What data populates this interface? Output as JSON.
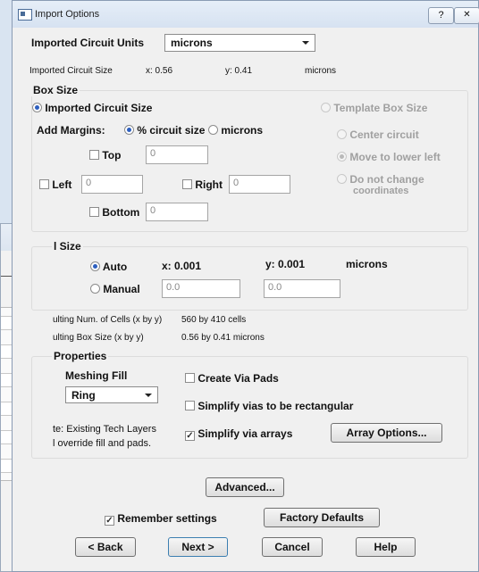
{
  "window": {
    "title": "Import Options",
    "help_button": "?",
    "close_button": "✕"
  },
  "units": {
    "label": "Imported Circuit Units",
    "value": "microns"
  },
  "circuit_size": {
    "label": "Imported Circuit Size",
    "x": "x: 0.56",
    "y": "y: 0.41",
    "units": "microns"
  },
  "box_size": {
    "title": "Box Size",
    "imported_option": "Imported Circuit Size",
    "template_option": "Template Box Size",
    "add_margins_label": "Add Margins:",
    "percent_option": "% circuit size",
    "microns_option": "microns",
    "top_label": "Top",
    "top_value": "0",
    "left_label": "Left",
    "left_value": "0",
    "right_label": "Right",
    "right_value": "0",
    "bottom_label": "Bottom",
    "bottom_value": "0",
    "center_option": "Center circuit",
    "move_option": "Move to lower left",
    "nochange_option_line1": "Do not change",
    "nochange_option_line2": "coordinates"
  },
  "cell_size": {
    "title": "l Size",
    "auto_option": "Auto",
    "manual_option": "Manual",
    "x": "x: 0.001",
    "y": "y: 0.001",
    "units": "microns",
    "manual_x": "0.0",
    "manual_y": "0.0"
  },
  "results": {
    "num_cells_label": "ulting Num. of Cells (x by y)",
    "num_cells_value": "560 by 410 cells",
    "box_size_label": "ulting Box Size (x by y)",
    "box_size_value": "0.56 by 0.41 microns"
  },
  "properties": {
    "title": "Properties",
    "meshing_fill_label": "Meshing Fill",
    "meshing_fill_value": "Ring",
    "note_line1": "te: Existing Tech Layers",
    "note_line2": "l override fill and pads.",
    "create_via_pads": "Create Via Pads",
    "simplify_vias": "Simplify vias to be rectangular",
    "simplify_arrays": "Simplify via arrays",
    "array_options_button": "Array Options..."
  },
  "buttons": {
    "advanced": "Advanced...",
    "remember": "Remember settings",
    "factory_defaults": "Factory Defaults",
    "back": "< Back",
    "next": "Next >",
    "cancel": "Cancel",
    "help": "Help"
  },
  "background_window": {
    "close": "✕"
  }
}
